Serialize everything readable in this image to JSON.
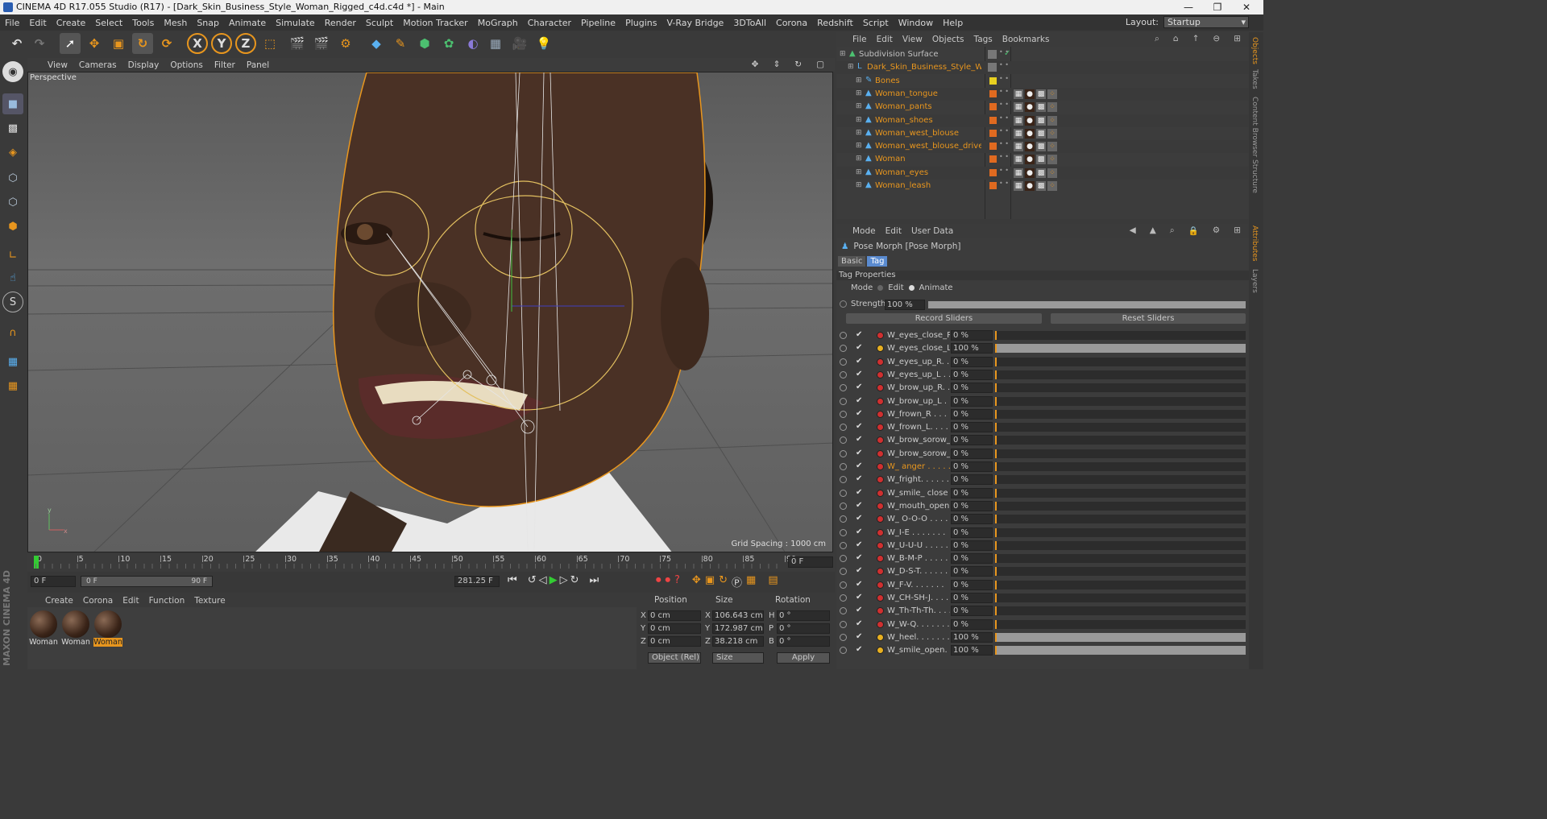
{
  "window": {
    "title": "CINEMA 4D R17.055 Studio (R17) - [Dark_Skin_Business_Style_Woman_Rigged_c4d.c4d *] - Main",
    "minimize": "—",
    "maximize": "❐",
    "close": "✕"
  },
  "menubar": [
    "File",
    "Edit",
    "Create",
    "Select",
    "Tools",
    "Mesh",
    "Snap",
    "Animate",
    "Simulate",
    "Render",
    "Sculpt",
    "Motion Tracker",
    "MoGraph",
    "Character",
    "Pipeline",
    "Plugins",
    "V-Ray Bridge",
    "3DToAll",
    "Corona",
    "Redshift",
    "Script",
    "Window",
    "Help"
  ],
  "layout": {
    "label": "Layout:",
    "value": "Startup"
  },
  "viewport": {
    "menu": [
      "View",
      "Cameras",
      "Display",
      "Options",
      "Filter",
      "Panel"
    ],
    "camera_label": "Perspective",
    "grid_spacing": "Grid Spacing : 1000 cm"
  },
  "timeline": {
    "ticks": [
      "0",
      "5",
      "10",
      "15",
      "20",
      "25",
      "30",
      "35",
      "40",
      "45",
      "50",
      "55",
      "60",
      "65",
      "70",
      "75",
      "80",
      "85",
      "90"
    ],
    "current_frame": "0 F",
    "start_field": "0 F",
    "range_start": "0 F",
    "range_end": "90 F",
    "fps_field": "281.25 F"
  },
  "material_manager": {
    "menu": [
      "Create",
      "Corona",
      "Edit",
      "Function",
      "Texture"
    ],
    "materials": [
      {
        "label": "Woman",
        "selected": false
      },
      {
        "label": "Woman",
        "selected": false
      },
      {
        "label": "Woman",
        "selected": true
      }
    ]
  },
  "coordinates": {
    "headers": [
      "Position",
      "Size",
      "Rotation"
    ],
    "rows": [
      {
        "axis": "X",
        "pos": "0 cm",
        "size_axis": "X",
        "size": "106.643 cm",
        "rot_axis": "H",
        "rot": "0 °"
      },
      {
        "axis": "Y",
        "pos": "0 cm",
        "size_axis": "Y",
        "size": "172.987 cm",
        "rot_axis": "P",
        "rot": "0 °"
      },
      {
        "axis": "Z",
        "pos": "0 cm",
        "size_axis": "Z",
        "size": "38.218 cm",
        "rot_axis": "B",
        "rot": "0 °"
      }
    ],
    "mode": "Object (Rel)",
    "size_mode": "Size",
    "apply": "Apply"
  },
  "object_manager": {
    "menu": [
      "File",
      "Edit",
      "View",
      "Objects",
      "Tags",
      "Bookmarks"
    ],
    "objects": [
      {
        "name": "Subdivision Surface",
        "indent": 0,
        "color": "#c0c0c0"
      },
      {
        "name": "Dark_Skin_Business_Style_Woman",
        "indent": 1,
        "color": "#e8961e"
      },
      {
        "name": "Bones",
        "indent": 2,
        "color": "#e8961e"
      },
      {
        "name": "Woman_tongue",
        "indent": 2,
        "color": "#e8961e"
      },
      {
        "name": "Woman_pants",
        "indent": 2,
        "color": "#e8961e"
      },
      {
        "name": "Woman_shoes",
        "indent": 2,
        "color": "#e8961e"
      },
      {
        "name": "Woman_west_blouse",
        "indent": 2,
        "color": "#e8961e"
      },
      {
        "name": "Woman_west_blouse_driver",
        "indent": 2,
        "color": "#e8961e"
      },
      {
        "name": "Woman",
        "indent": 2,
        "color": "#e8961e"
      },
      {
        "name": "Woman_eyes",
        "indent": 2,
        "color": "#e8961e"
      },
      {
        "name": "Woman_leash",
        "indent": 2,
        "color": "#e8961e"
      }
    ]
  },
  "attributes": {
    "menu": [
      "Mode",
      "Edit",
      "User Data"
    ],
    "title": "Pose Morph [Pose Morph]",
    "tabs": [
      "Basic",
      "Tag"
    ],
    "section": "Tag Properties",
    "mode_label": "Mode",
    "mode_edit": "Edit",
    "mode_animate": "Animate",
    "strength_label": "Strength",
    "strength_value": "100 %",
    "strength_fraction": 1.0,
    "record": "Record Sliders",
    "reset": "Reset Sliders",
    "sliders": [
      {
        "name": "W_eyes_close_R.",
        "value": "0 %",
        "fraction": 0,
        "highlight": false
      },
      {
        "name": "W_eyes_close_L.",
        "value": "100 %",
        "fraction": 1,
        "highlight": false
      },
      {
        "name": "W_eyes_up_R. .",
        "value": "0 %",
        "fraction": 0,
        "highlight": false
      },
      {
        "name": "W_eyes_up_L . .",
        "value": "0 %",
        "fraction": 0,
        "highlight": false
      },
      {
        "name": "W_brow_up_R. .",
        "value": "0 %",
        "fraction": 0,
        "highlight": false
      },
      {
        "name": "W_brow_up_L . .",
        "value": "0 %",
        "fraction": 0,
        "highlight": false
      },
      {
        "name": "W_frown_R . . .",
        "value": "0 %",
        "fraction": 0,
        "highlight": false
      },
      {
        "name": "W_frown_L. . . .",
        "value": "0 %",
        "fraction": 0,
        "highlight": false
      },
      {
        "name": "W_brow_sorow_R",
        "value": "0 %",
        "fraction": 0,
        "highlight": false
      },
      {
        "name": "W_brow_sorow_L",
        "value": "0 %",
        "fraction": 0,
        "highlight": false
      },
      {
        "name": "W_ anger . . . . .",
        "value": "0 %",
        "fraction": 0,
        "highlight": true
      },
      {
        "name": "W_fright. . . . . .",
        "value": "0 %",
        "fraction": 0,
        "highlight": false
      },
      {
        "name": "W_smile_ close . .",
        "value": "0 %",
        "fraction": 0,
        "highlight": false
      },
      {
        "name": "W_mouth_open",
        "value": "0 %",
        "fraction": 0,
        "highlight": false
      },
      {
        "name": "W_ O-O-O . . . .",
        "value": "0 %",
        "fraction": 0,
        "highlight": false
      },
      {
        "name": "W_I-E . . . . . . .",
        "value": "0 %",
        "fraction": 0,
        "highlight": false
      },
      {
        "name": "W_U-U-U . . . . .",
        "value": "0 %",
        "fraction": 0,
        "highlight": false
      },
      {
        "name": "W_B-M-P . . . . .",
        "value": "0 %",
        "fraction": 0,
        "highlight": false
      },
      {
        "name": "W_D-S-T. . . . . .",
        "value": "0 %",
        "fraction": 0,
        "highlight": false
      },
      {
        "name": "W_F-V. . . . . . .",
        "value": "0 %",
        "fraction": 0,
        "highlight": false
      },
      {
        "name": "W_CH-SH-J. . . .",
        "value": "0 %",
        "fraction": 0,
        "highlight": false
      },
      {
        "name": "W_Th-Th-Th. . . .",
        "value": "0 %",
        "fraction": 0,
        "highlight": false
      },
      {
        "name": "W_W-Q. . . . . . .",
        "value": "0 %",
        "fraction": 0,
        "highlight": false
      },
      {
        "name": "W_heel. . . . . . .",
        "value": "100 %",
        "fraction": 1,
        "highlight": false
      },
      {
        "name": "W_smile_open. . .",
        "value": "100 %",
        "fraction": 1,
        "highlight": false
      }
    ]
  },
  "side_tabs": [
    "Objects",
    "Takes",
    "Content Browser",
    "Structure",
    "Attributes",
    "Layers"
  ],
  "brand": "MAXON CINEMA 4D",
  "colors": {
    "accent": "#e8961e",
    "panel": "#3c3c3c",
    "dark": "#2e2e2e",
    "blue": "#4a90d9"
  }
}
